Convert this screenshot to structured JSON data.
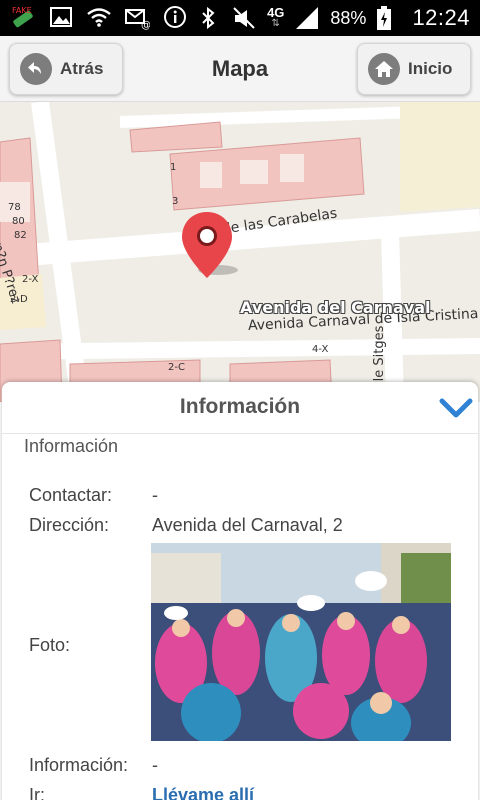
{
  "status_bar": {
    "battery": "88%",
    "time": "12:24",
    "network": "4G",
    "icons": [
      "app-notification-icon",
      "gallery-icon",
      "wifi-icon",
      "mail-icon",
      "info-icon",
      "bluetooth-icon",
      "mute-icon",
      "signal-icon",
      "battery-icon"
    ]
  },
  "header": {
    "back_label": "Atrás",
    "title": "Mapa",
    "home_label": "Inicio"
  },
  "map": {
    "label_calle_carabelas": "Calle las Carabelas",
    "label_avenida_carnaval": "Avenida del Carnaval",
    "label_avenida_isla": "Avenida Carnaval de Isla Cristina",
    "label_calle_sitges": "Calle Sitges",
    "label_lateral": "om?n P?rez",
    "marker_icon": "map-pin-icon",
    "house_numbers": [
      "78",
      "80",
      "82",
      "1",
      "3",
      "2-X",
      "2-D",
      "2-C",
      "4-X"
    ]
  },
  "panel": {
    "title": "Información",
    "section_label": "Información",
    "rows": {
      "contactar_label": "Contactar:",
      "contactar_value": "-",
      "direccion_label": "Dirección:",
      "direccion_value": "Avenida del Carnaval, 2",
      "foto_label": "Foto:",
      "informacion_label": "Información:",
      "informacion_value": "-",
      "ir_label": "Ir:",
      "ir_value": "Llévame allí"
    }
  },
  "colors": {
    "marker": "#e8454a",
    "link": "#2a6db0",
    "chevron": "#2f82d4",
    "buildings": "#f2c4c0"
  }
}
